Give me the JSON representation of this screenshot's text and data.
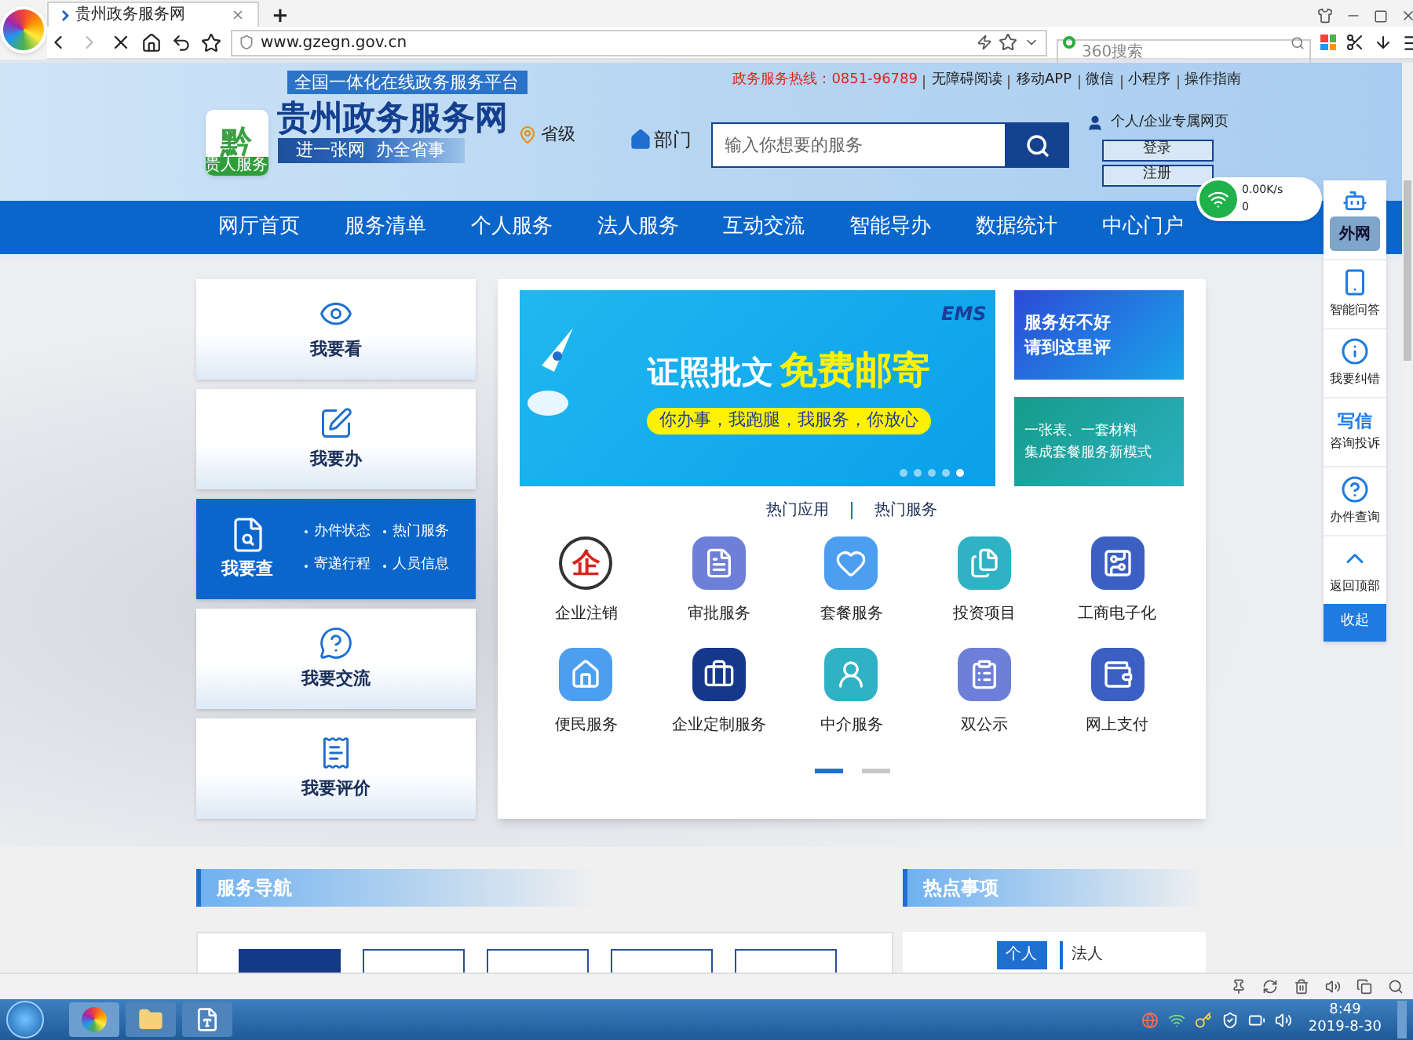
{
  "browser": {
    "tab_title": "贵州政务服务网",
    "new_tab": "+",
    "url": "www.gzegn.gov.cn",
    "search_placeholder": "360搜索"
  },
  "header": {
    "platform": "全国一体化在线政务服务平台",
    "logo_char": "黔",
    "logo_strip": "贵人服务",
    "site_title": "贵州政务服务网",
    "slogan": "进一张网  办全省事",
    "region": "省级",
    "department": "部门",
    "search_placeholder": "输入你想要的服务",
    "hotline": "政务服务热线：0851-96789",
    "links": [
      "无障碍阅读",
      "移动APP",
      "微信",
      "小程序",
      "操作指南"
    ],
    "user_link": "个人/企业专属网页",
    "buttons": [
      "登录",
      "注册"
    ]
  },
  "nav": [
    "网厅首页",
    "服务清单",
    "个人服务",
    "法人服务",
    "互动交流",
    "智能导办",
    "数据统计",
    "中心门户"
  ],
  "quick_cards": [
    {
      "label": "我要看",
      "kind": "view",
      "selected": false
    },
    {
      "label": "我要办",
      "kind": "edit",
      "selected": false
    },
    {
      "label": "我要查",
      "kind": "search",
      "selected": true,
      "links": [
        "办件状态",
        "热门服务",
        "寄递行程",
        "人员信息"
      ]
    },
    {
      "label": "我要交流",
      "kind": "chat",
      "selected": false
    },
    {
      "label": "我要评价",
      "kind": "review",
      "selected": false
    }
  ],
  "banner": {
    "brand": "EMS",
    "headline": "证照批文",
    "headline_highlight": "免费邮寄",
    "tagline": "你办事，我跑腿，我服务，你放心",
    "dots": [
      {
        "selected": false
      },
      {
        "selected": false
      },
      {
        "selected": false
      },
      {
        "selected": false
      },
      {
        "selected": true
      }
    ]
  },
  "side_ads": [
    {
      "kind": "rate",
      "lines": [
        "服务好不好",
        "请到这里评"
      ]
    },
    {
      "kind": "package",
      "lines": [
        "一张表、一套材料",
        "集成套餐服务新模式"
      ]
    }
  ],
  "hot_tabs": [
    "热门应用",
    "热门服务"
  ],
  "apps": [
    {
      "label": "企业注销",
      "kind": "glyph",
      "glyph": "企",
      "color": "#ffffff"
    },
    {
      "label": "审批服务",
      "kind": "document",
      "color": "#6d7fd8"
    },
    {
      "label": "套餐服务",
      "kind": "heart",
      "color": "#4b9ef0"
    },
    {
      "label": "投资项目",
      "kind": "files",
      "color": "#2fb3c4"
    },
    {
      "label": "工商电子化",
      "kind": "circuit",
      "color": "#3b5fc2"
    },
    {
      "label": "便民服务",
      "kind": "house",
      "color": "#4b9ef0"
    },
    {
      "label": "企业定制服务",
      "kind": "briefcase",
      "color": "#16388c"
    },
    {
      "label": "中介服务",
      "kind": "person",
      "color": "#2fb3c4"
    },
    {
      "label": "双公示",
      "kind": "clipboard",
      "color": "#6d7fd8"
    },
    {
      "label": "网上支付",
      "kind": "wallet",
      "color": "#3b5fc2"
    }
  ],
  "app_pages": [
    {
      "selected": true
    },
    {
      "selected": false
    }
  ],
  "service_nav": {
    "title": "服务导航",
    "tabs": [
      {
        "selected": true
      },
      {
        "selected": false
      },
      {
        "selected": false
      },
      {
        "selected": false
      },
      {
        "selected": false
      }
    ]
  },
  "hot_items": {
    "title": "热点事项",
    "tabs": [
      {
        "label": "个人",
        "selected": true
      },
      {
        "label": "法人",
        "selected": false
      }
    ]
  },
  "net_widget": {
    "speed": "0.00K/s",
    "count": "0"
  },
  "float_sidebar": {
    "badge": "外网",
    "items": [
      {
        "label": "智能问答",
        "kind": "phone"
      },
      {
        "label": "我要纠错",
        "kind": "info"
      },
      {
        "label": "咨询投诉",
        "kind": "text",
        "glyph": "写信"
      },
      {
        "label": "办件查询",
        "kind": "help"
      },
      {
        "label": "返回顶部",
        "kind": "top"
      }
    ],
    "collapse": "收起"
  },
  "clock": {
    "time": "8:49",
    "date": "2019-8-30"
  }
}
